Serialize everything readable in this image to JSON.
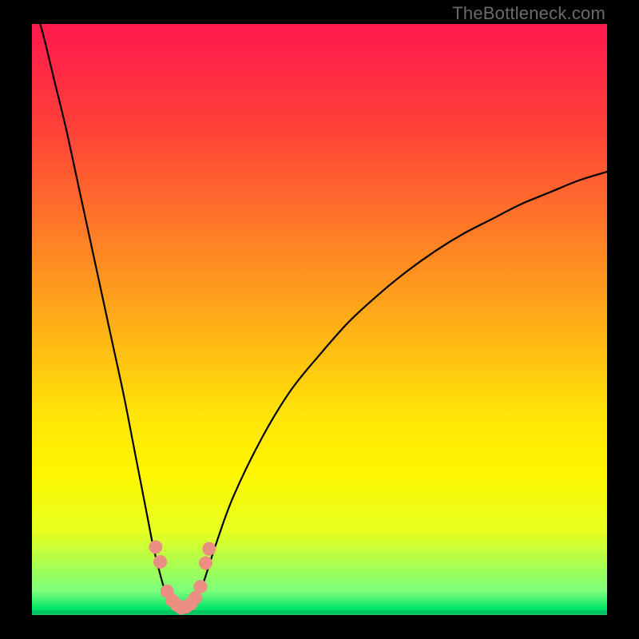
{
  "watermark": "TheBottleneck.com",
  "chart_data": {
    "type": "line",
    "title": "",
    "xlabel": "",
    "ylabel": "",
    "x": [
      0,
      2,
      4,
      6,
      8,
      10,
      12,
      14,
      16,
      18,
      20,
      21,
      22,
      23,
      24,
      25,
      26,
      27,
      28,
      29,
      30,
      32,
      35,
      40,
      45,
      50,
      55,
      60,
      65,
      70,
      75,
      80,
      85,
      90,
      95,
      100
    ],
    "values": [
      105,
      98,
      90,
      82,
      73,
      64,
      55,
      46,
      37,
      27,
      17,
      12,
      8,
      4.5,
      2.5,
      1.5,
      1,
      1.3,
      2,
      3.5,
      6,
      12,
      20,
      30,
      38,
      44,
      49.5,
      54,
      58,
      61.5,
      64.5,
      67,
      69.5,
      71.5,
      73.5,
      75
    ],
    "xlim": [
      0,
      100
    ],
    "ylim": [
      0,
      100
    ],
    "annotations": {
      "beads_x": [
        21.5,
        22.3,
        23.5,
        24.4,
        25.2,
        26.0,
        26.8,
        27.6,
        28.4,
        29.3,
        30.2,
        30.8
      ],
      "beads_y": [
        11.5,
        9.0,
        4.0,
        2.5,
        1.7,
        1.2,
        1.4,
        1.9,
        2.9,
        4.8,
        8.8,
        11.2
      ]
    },
    "background_gradient": {
      "stops": [
        {
          "pos": 0.0,
          "color": "#ff1a4d"
        },
        {
          "pos": 0.3,
          "color": "#ff6a2c"
        },
        {
          "pos": 0.66,
          "color": "#ffe408"
        },
        {
          "pos": 0.86,
          "color": "#e6ff20"
        },
        {
          "pos": 0.99,
          "color": "#00e56a"
        }
      ]
    }
  }
}
